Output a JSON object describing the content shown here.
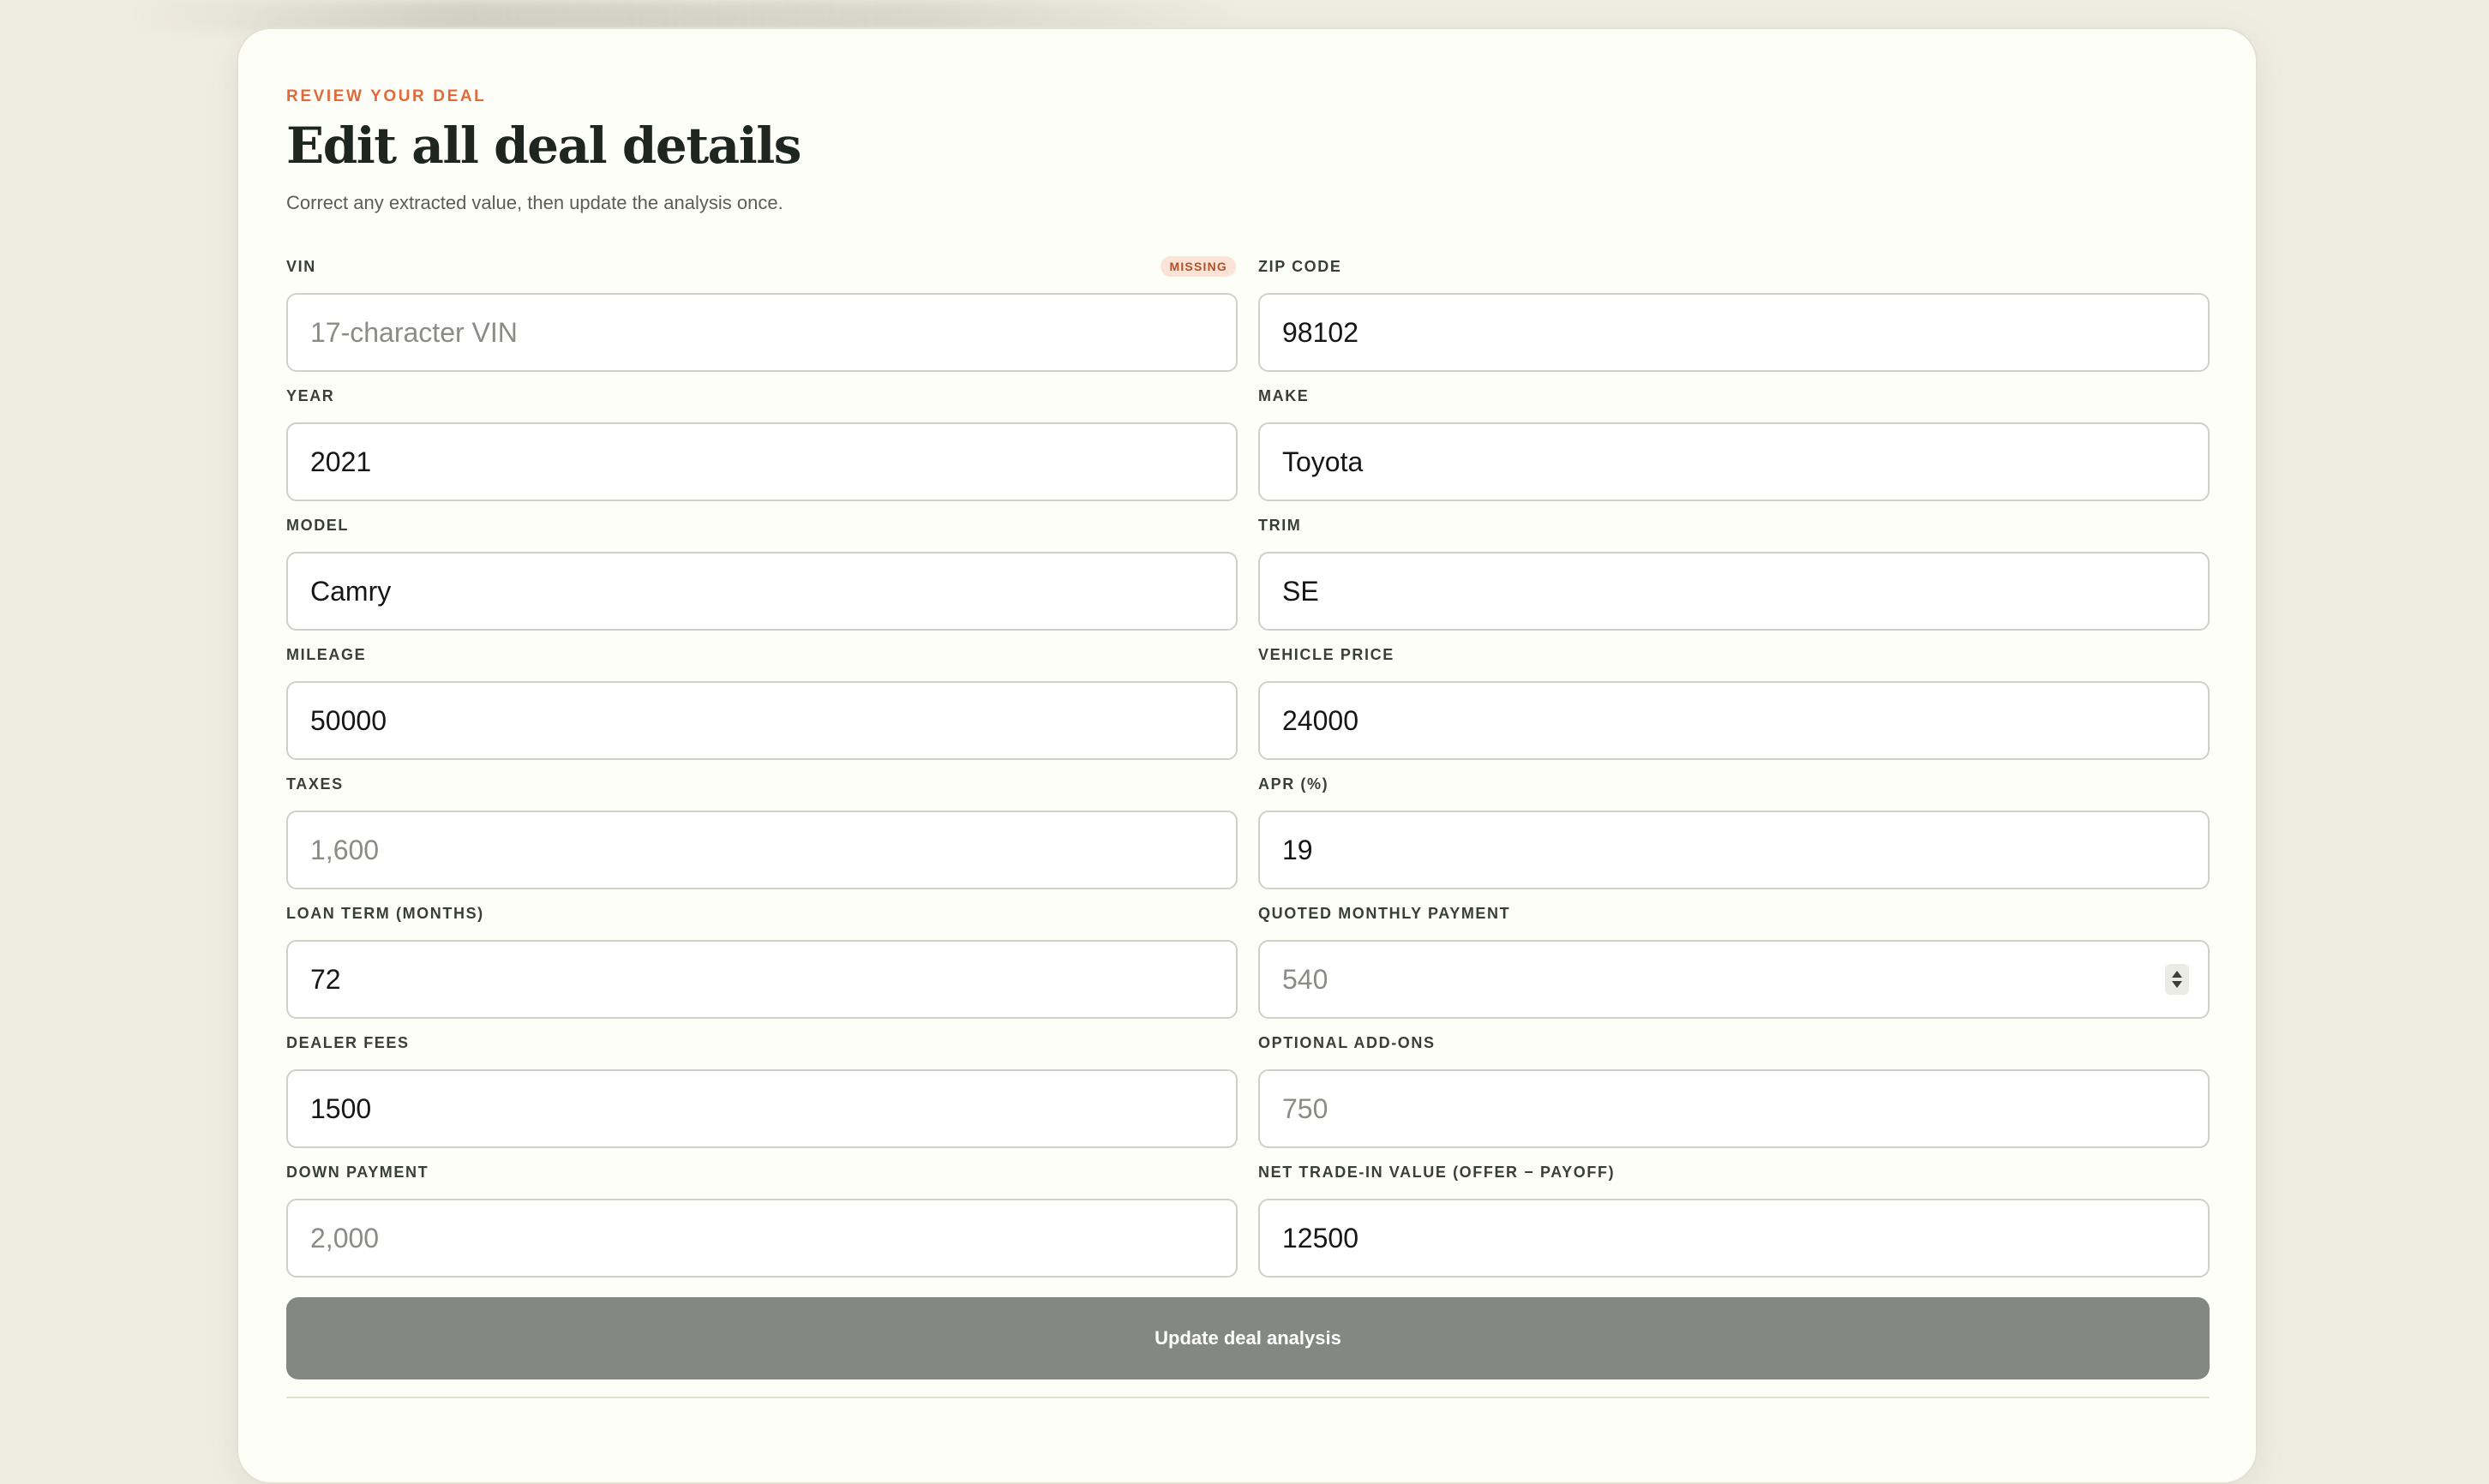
{
  "header": {
    "eyebrow": "REVIEW YOUR DEAL",
    "title": "Edit all deal details",
    "subtitle": "Correct any extracted value, then update the analysis once."
  },
  "fields": {
    "vin": {
      "label": "VIN",
      "badge": "MISSING",
      "value": "",
      "placeholder": "17-character VIN"
    },
    "zip": {
      "label": "ZIP CODE",
      "value": "98102",
      "placeholder": ""
    },
    "year": {
      "label": "YEAR",
      "value": "2021",
      "placeholder": ""
    },
    "make": {
      "label": "MAKE",
      "value": "Toyota",
      "placeholder": ""
    },
    "model": {
      "label": "MODEL",
      "value": "Camry",
      "placeholder": ""
    },
    "trim": {
      "label": "TRIM",
      "value": "SE",
      "placeholder": ""
    },
    "mileage": {
      "label": "MILEAGE",
      "value": "50000",
      "placeholder": ""
    },
    "vehicle_price": {
      "label": "VEHICLE PRICE",
      "value": "24000",
      "placeholder": ""
    },
    "taxes": {
      "label": "TAXES",
      "value": "",
      "placeholder": "1,600"
    },
    "apr": {
      "label": "APR (%)",
      "value": "19",
      "placeholder": ""
    },
    "loan_term": {
      "label": "LOAN TERM (MONTHS)",
      "value": "72",
      "placeholder": ""
    },
    "monthly_payment": {
      "label": "QUOTED MONTHLY PAYMENT",
      "value": "",
      "placeholder": "540"
    },
    "dealer_fees": {
      "label": "DEALER FEES",
      "value": "1500",
      "placeholder": ""
    },
    "addons": {
      "label": "OPTIONAL ADD-ONS",
      "value": "",
      "placeholder": "750"
    },
    "down_payment": {
      "label": "DOWN PAYMENT",
      "value": "",
      "placeholder": "2,000"
    },
    "trade_in": {
      "label": "NET TRADE-IN VALUE (OFFER − PAYOFF)",
      "value": "12500",
      "placeholder": ""
    }
  },
  "actions": {
    "update_label": "Update deal analysis"
  },
  "colors": {
    "accent": "#e16a3a",
    "card_bg": "#fefef8",
    "page_bg": "#efece2",
    "button_bg": "#838884"
  }
}
